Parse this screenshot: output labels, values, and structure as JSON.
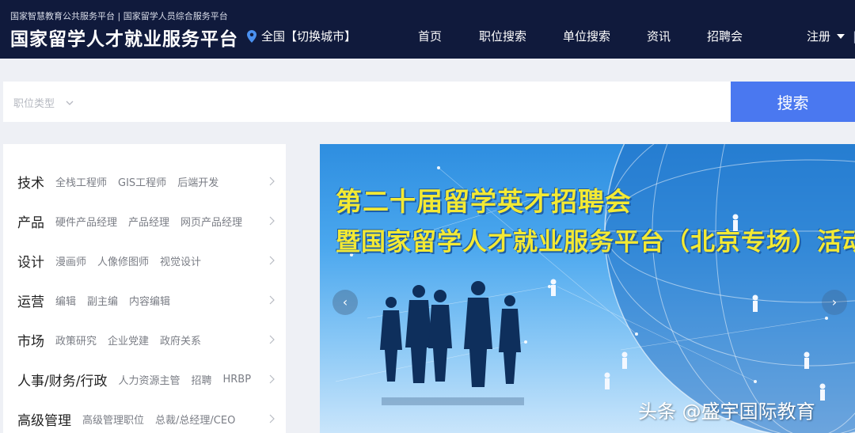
{
  "header": {
    "subtitle": "国家智慧教育公共服务平台 | 国家留学人员综合服务平台",
    "title": "国家留学人才就业服务平台",
    "city": "全国【切换城市】",
    "nav": [
      "首页",
      "职位搜索",
      "单位搜索",
      "资讯",
      "招聘会"
    ],
    "register": "注册",
    "separator": "|"
  },
  "search": {
    "type_label": "职位类型",
    "placeholder": "",
    "button_label": "搜索"
  },
  "categories": [
    {
      "name": "技术",
      "tags": [
        "全栈工程师",
        "GIS工程师",
        "后端开发"
      ]
    },
    {
      "name": "产品",
      "tags": [
        "硬件产品经理",
        "产品经理",
        "网页产品经理"
      ]
    },
    {
      "name": "设计",
      "tags": [
        "漫画师",
        "人像修图师",
        "视觉设计"
      ]
    },
    {
      "name": "运营",
      "tags": [
        "编辑",
        "副主编",
        "内容编辑"
      ]
    },
    {
      "name": "市场",
      "tags": [
        "政策研究",
        "企业党建",
        "政府关系"
      ]
    },
    {
      "name": "人事/财务/行政",
      "tags": [
        "人力资源主管",
        "招聘",
        "HRBP"
      ]
    },
    {
      "name": "高级管理",
      "tags": [
        "高级管理职位",
        "总裁/总经理/CEO"
      ]
    }
  ],
  "banner": {
    "line1": "第二十届留学英才招聘会",
    "line2": "暨国家留学人才就业服务平台（北京专场）活动",
    "prev": "‹",
    "next": "›",
    "watermark": "头条 @盛宇国际教育"
  },
  "colors": {
    "header_bg": "#101a3c",
    "search_button": "#4a78f0",
    "banner_text": "#f3e934"
  }
}
